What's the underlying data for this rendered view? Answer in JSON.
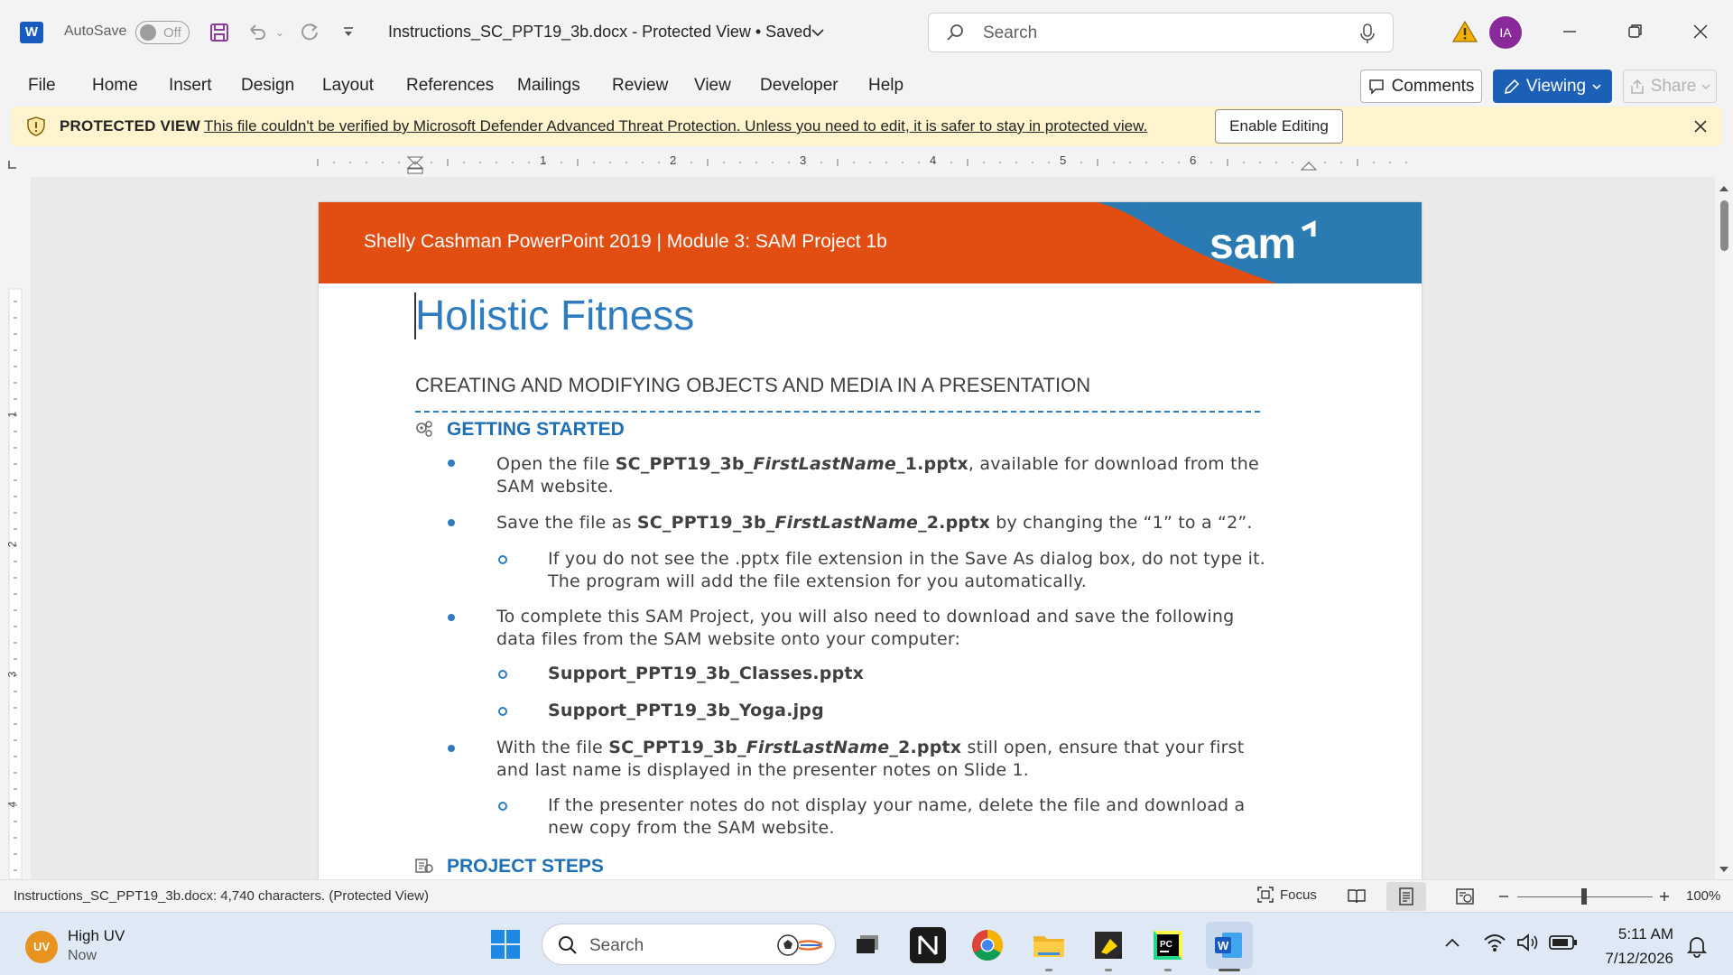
{
  "titlebar": {
    "autosave_label": "AutoSave",
    "autosave_state": "Off",
    "doc_title": "Instructions_SC_PPT19_3b.docx  -  Protected View • Saved",
    "search_placeholder": "Search",
    "avatar_initials": "IA"
  },
  "ribbon": {
    "tabs": [
      "File",
      "Home",
      "Insert",
      "Design",
      "Layout",
      "References",
      "Mailings",
      "Review",
      "View",
      "Developer",
      "Help"
    ],
    "comments_label": "Comments",
    "viewing_label": "Viewing",
    "share_label": "Share"
  },
  "protected_view": {
    "title": "PROTECTED VIEW",
    "message": "This file couldn't be verified by Microsoft Defender Advanced Threat Protection. Unless you need to edit, it is safer to stay in protected view.",
    "enable_label": "Enable Editing"
  },
  "ruler": {
    "h_numbers": [
      "1",
      "2",
      "3",
      "4",
      "5",
      "6"
    ],
    "v_numbers": [
      "1",
      "2",
      "3",
      "4"
    ]
  },
  "document": {
    "banner_text": "Shelly Cashman PowerPoint 2019 | Module 3: SAM Project 1b",
    "logo_text": "sam",
    "title": "Holistic Fitness",
    "subtitle": "CREATING AND MODIFYING OBJECTS AND MEDIA IN A PRESENTATION",
    "section1": "GETTING STARTED",
    "section2": "PROJECT STEPS",
    "b1_pre": "Open the file ",
    "b1_bold1": "SC_PPT19_3b_",
    "b1_italic": "FirstLastName",
    "b1_bold2": "_1.pptx",
    "b1_post": ", available for download from the",
    "b1_line2": "SAM website.",
    "b2_pre": "Save the file as ",
    "b2_bold1": "SC_PPT19_3b_",
    "b2_italic": "FirstLastName",
    "b2_bold2": "_2.pptx",
    "b2_post": " by changing the “1” to a “2”.",
    "s1_line1": "If you do not see the .pptx file extension in the Save As dialog box, do not type it.",
    "s1_line2": "The program will add the file extension for you automatically.",
    "b3_line1": "To complete this SAM Project, you will also need to download and save the following",
    "b3_line2": "data files from the SAM website onto your computer:",
    "file1": "Support_PPT19_3b_Classes.pptx",
    "file2": "Support_PPT19_3b_Yoga.jpg",
    "b4_pre": "With the file ",
    "b4_bold1": "SC_PPT19_3b_",
    "b4_italic": "FirstLastName",
    "b4_bold2": "_2.pptx",
    "b4_post": " still open, ensure that your first",
    "b4_line2": "and last name is displayed in the presenter notes on Slide 1.",
    "s2_line1": "If the presenter notes do not display your name, delete the file and download a",
    "s2_line2": "new copy from the SAM website."
  },
  "statusbar": {
    "doc_info": "Instructions_SC_PPT19_3b.docx: 4,740 characters.  (Protected View)",
    "focus_label": "Focus",
    "zoom": "100%"
  },
  "taskbar": {
    "weather_badge": "UV",
    "weather_title": "High UV",
    "weather_sub": "Now",
    "search_label": "Search",
    "time": "5:11 AM",
    "date": "7/12/2026"
  },
  "colors": {
    "accent_blue": "#1c5fb7",
    "banner_orange": "#e24e12",
    "heading_blue": "#2f7bc0",
    "protected_bg": "#fff4ce"
  }
}
